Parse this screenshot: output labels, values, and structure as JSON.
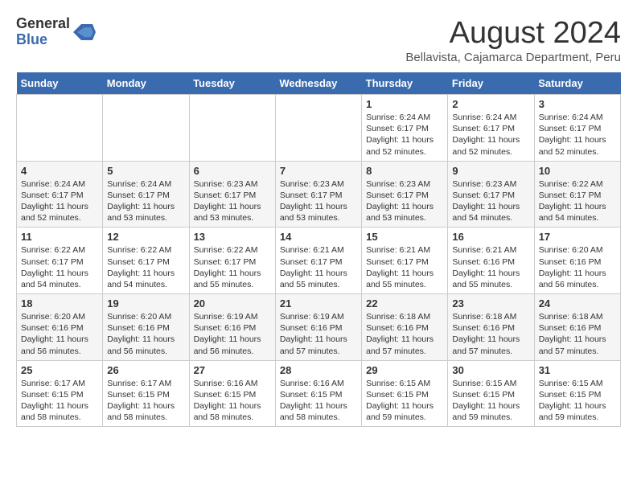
{
  "header": {
    "logo_general": "General",
    "logo_blue": "Blue",
    "month_year": "August 2024",
    "location": "Bellavista, Cajamarca Department, Peru"
  },
  "days_of_week": [
    "Sunday",
    "Monday",
    "Tuesday",
    "Wednesday",
    "Thursday",
    "Friday",
    "Saturday"
  ],
  "weeks": [
    [
      {
        "day": "",
        "info": ""
      },
      {
        "day": "",
        "info": ""
      },
      {
        "day": "",
        "info": ""
      },
      {
        "day": "",
        "info": ""
      },
      {
        "day": "1",
        "info": "Sunrise: 6:24 AM\nSunset: 6:17 PM\nDaylight: 11 hours\nand 52 minutes."
      },
      {
        "day": "2",
        "info": "Sunrise: 6:24 AM\nSunset: 6:17 PM\nDaylight: 11 hours\nand 52 minutes."
      },
      {
        "day": "3",
        "info": "Sunrise: 6:24 AM\nSunset: 6:17 PM\nDaylight: 11 hours\nand 52 minutes."
      }
    ],
    [
      {
        "day": "4",
        "info": "Sunrise: 6:24 AM\nSunset: 6:17 PM\nDaylight: 11 hours\nand 52 minutes."
      },
      {
        "day": "5",
        "info": "Sunrise: 6:24 AM\nSunset: 6:17 PM\nDaylight: 11 hours\nand 53 minutes."
      },
      {
        "day": "6",
        "info": "Sunrise: 6:23 AM\nSunset: 6:17 PM\nDaylight: 11 hours\nand 53 minutes."
      },
      {
        "day": "7",
        "info": "Sunrise: 6:23 AM\nSunset: 6:17 PM\nDaylight: 11 hours\nand 53 minutes."
      },
      {
        "day": "8",
        "info": "Sunrise: 6:23 AM\nSunset: 6:17 PM\nDaylight: 11 hours\nand 53 minutes."
      },
      {
        "day": "9",
        "info": "Sunrise: 6:23 AM\nSunset: 6:17 PM\nDaylight: 11 hours\nand 54 minutes."
      },
      {
        "day": "10",
        "info": "Sunrise: 6:22 AM\nSunset: 6:17 PM\nDaylight: 11 hours\nand 54 minutes."
      }
    ],
    [
      {
        "day": "11",
        "info": "Sunrise: 6:22 AM\nSunset: 6:17 PM\nDaylight: 11 hours\nand 54 minutes."
      },
      {
        "day": "12",
        "info": "Sunrise: 6:22 AM\nSunset: 6:17 PM\nDaylight: 11 hours\nand 54 minutes."
      },
      {
        "day": "13",
        "info": "Sunrise: 6:22 AM\nSunset: 6:17 PM\nDaylight: 11 hours\nand 55 minutes."
      },
      {
        "day": "14",
        "info": "Sunrise: 6:21 AM\nSunset: 6:17 PM\nDaylight: 11 hours\nand 55 minutes."
      },
      {
        "day": "15",
        "info": "Sunrise: 6:21 AM\nSunset: 6:17 PM\nDaylight: 11 hours\nand 55 minutes."
      },
      {
        "day": "16",
        "info": "Sunrise: 6:21 AM\nSunset: 6:16 PM\nDaylight: 11 hours\nand 55 minutes."
      },
      {
        "day": "17",
        "info": "Sunrise: 6:20 AM\nSunset: 6:16 PM\nDaylight: 11 hours\nand 56 minutes."
      }
    ],
    [
      {
        "day": "18",
        "info": "Sunrise: 6:20 AM\nSunset: 6:16 PM\nDaylight: 11 hours\nand 56 minutes."
      },
      {
        "day": "19",
        "info": "Sunrise: 6:20 AM\nSunset: 6:16 PM\nDaylight: 11 hours\nand 56 minutes."
      },
      {
        "day": "20",
        "info": "Sunrise: 6:19 AM\nSunset: 6:16 PM\nDaylight: 11 hours\nand 56 minutes."
      },
      {
        "day": "21",
        "info": "Sunrise: 6:19 AM\nSunset: 6:16 PM\nDaylight: 11 hours\nand 57 minutes."
      },
      {
        "day": "22",
        "info": "Sunrise: 6:18 AM\nSunset: 6:16 PM\nDaylight: 11 hours\nand 57 minutes."
      },
      {
        "day": "23",
        "info": "Sunrise: 6:18 AM\nSunset: 6:16 PM\nDaylight: 11 hours\nand 57 minutes."
      },
      {
        "day": "24",
        "info": "Sunrise: 6:18 AM\nSunset: 6:16 PM\nDaylight: 11 hours\nand 57 minutes."
      }
    ],
    [
      {
        "day": "25",
        "info": "Sunrise: 6:17 AM\nSunset: 6:15 PM\nDaylight: 11 hours\nand 58 minutes."
      },
      {
        "day": "26",
        "info": "Sunrise: 6:17 AM\nSunset: 6:15 PM\nDaylight: 11 hours\nand 58 minutes."
      },
      {
        "day": "27",
        "info": "Sunrise: 6:16 AM\nSunset: 6:15 PM\nDaylight: 11 hours\nand 58 minutes."
      },
      {
        "day": "28",
        "info": "Sunrise: 6:16 AM\nSunset: 6:15 PM\nDaylight: 11 hours\nand 58 minutes."
      },
      {
        "day": "29",
        "info": "Sunrise: 6:15 AM\nSunset: 6:15 PM\nDaylight: 11 hours\nand 59 minutes."
      },
      {
        "day": "30",
        "info": "Sunrise: 6:15 AM\nSunset: 6:15 PM\nDaylight: 11 hours\nand 59 minutes."
      },
      {
        "day": "31",
        "info": "Sunrise: 6:15 AM\nSunset: 6:15 PM\nDaylight: 11 hours\nand 59 minutes."
      }
    ]
  ]
}
